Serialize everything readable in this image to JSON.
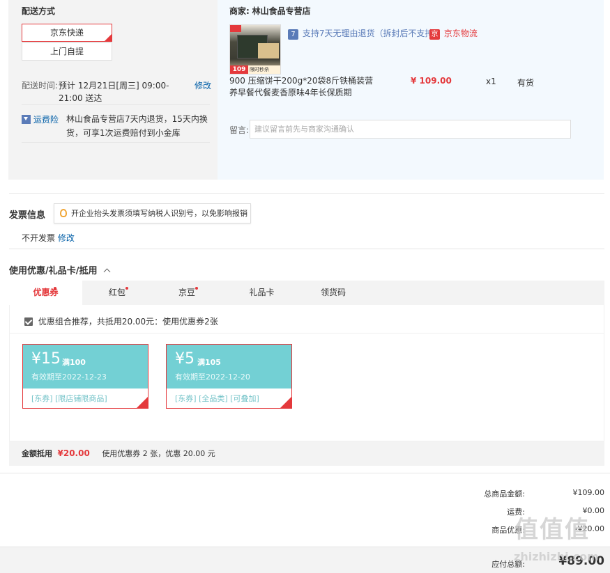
{
  "shipping": {
    "title": "配送方式",
    "options": [
      "京东快递",
      "上门自提"
    ],
    "time_label": "配送时间:",
    "time_value": "预计 12月21日[周三] 09:00-21:00 送达",
    "modify": "修改",
    "insurance_label": "运费险",
    "insurance_text": "林山食品专营店7天内退货，15天内换货，可享1次运费赔付到小金库"
  },
  "store": {
    "merchant_label": "商家:",
    "merchant_name": "林山食品专营店",
    "return_badge": "7",
    "return_text": "支持7天无理由退货（拆封后不支持）",
    "logistics_badge": "京",
    "logistics_text": "京东物流",
    "product_title": "900 压缩饼干200g*20袋8斤铁桶装营养早餐代餐麦香原味4年长保质期",
    "img_price": "109",
    "img_promo": "限时秒杀",
    "price": "¥ 109.00",
    "qty": "x1",
    "stock": "有货",
    "message_label": "留言:",
    "message_placeholder": "建议留言前先与商家沟通确认"
  },
  "invoice": {
    "title": "发票信息",
    "tip": "开企业抬头发票须填写纳税人识别号，以免影响报销",
    "status": "不开发票",
    "modify": "修改"
  },
  "coupons": {
    "title": "使用优惠/礼品卡/抵用",
    "tabs": [
      "优惠券",
      "红包",
      "京豆",
      "礼品卡",
      "领货码"
    ],
    "combo_text": "优惠组合推荐，共抵用20.00元：使用优惠券2张",
    "items": [
      {
        "amount": "¥15",
        "condition": "满100",
        "valid": "有效期至2022-12-23",
        "tags": "[东券]   [限店铺限商品]"
      },
      {
        "amount": "¥5",
        "condition": "满105",
        "valid": "有效期至2022-12-20",
        "tags": "[东券]   [全品类]   [可叠加]"
      }
    ],
    "summary_label": "金额抵用",
    "summary_amount": "¥20.00",
    "summary_text": "使用优惠券 2 张，优惠 20.00 元"
  },
  "totals": {
    "goods_label": "总商品金额:",
    "goods_value": "¥109.00",
    "freight_label": "运费:",
    "freight_value": "¥0.00",
    "discount_label": "商品优惠:",
    "discount_value": "-¥20.00",
    "pay_label": "应付总额:",
    "pay_value": "¥89.00"
  },
  "watermark": {
    "logo": "值值值",
    "site": "zhizhizhi.com"
  },
  "colors": {
    "accent": "#e4393c",
    "link": "#005ea7",
    "coupon": "#73d0d4"
  }
}
